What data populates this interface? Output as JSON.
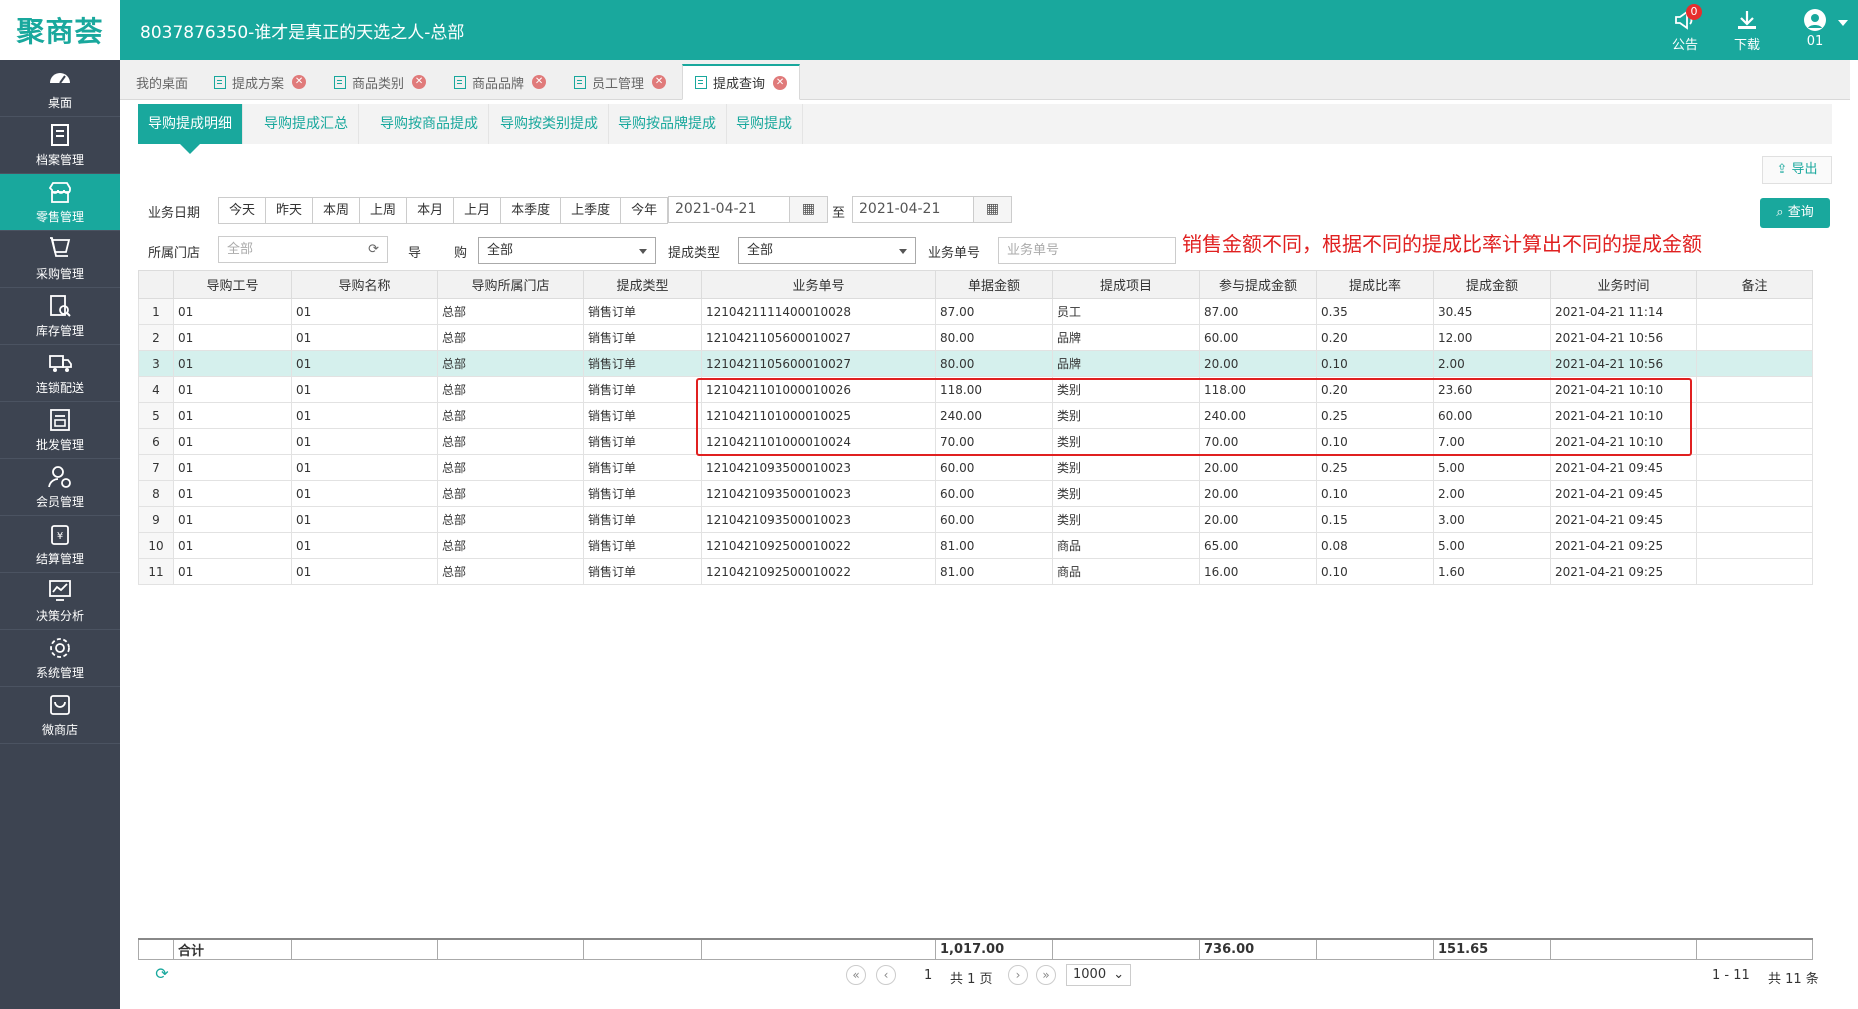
{
  "header": {
    "logo": "聚商荟",
    "title": "8037876350-谁才是真正的天选之人-总部",
    "notice_label": "公告",
    "notice_count": "0",
    "download_label": "下载",
    "user_label": "01"
  },
  "sidebar": {
    "items": [
      {
        "label": "桌面",
        "icon": "dashboard-icon"
      },
      {
        "label": "档案管理",
        "icon": "archive-icon"
      },
      {
        "label": "零售管理",
        "icon": "store-icon",
        "active": true
      },
      {
        "label": "采购管理",
        "icon": "purchase-icon"
      },
      {
        "label": "库存管理",
        "icon": "inventory-icon"
      },
      {
        "label": "连锁配送",
        "icon": "truck-icon"
      },
      {
        "label": "批发管理",
        "icon": "wholesale-icon"
      },
      {
        "label": "会员管理",
        "icon": "member-icon"
      },
      {
        "label": "结算管理",
        "icon": "settlement-icon"
      },
      {
        "label": "决策分析",
        "icon": "chart-icon"
      },
      {
        "label": "系统管理",
        "icon": "gear-icon"
      },
      {
        "label": "微商店",
        "icon": "shop-bag-icon"
      }
    ]
  },
  "tabs": [
    {
      "label": "我的桌面"
    },
    {
      "label": "提成方案"
    },
    {
      "label": "商品类别"
    },
    {
      "label": "商品品牌"
    },
    {
      "label": "员工管理"
    },
    {
      "label": "提成查询"
    }
  ],
  "subtabs": [
    "导购提成明细",
    "导购提成汇总",
    "导购按商品提成",
    "导购按类别提成",
    "导购按品牌提成",
    "导购提成"
  ],
  "toolbar": {
    "export_label": "导出",
    "query_label": "查询"
  },
  "filters": {
    "date_label": "业务日期",
    "date_buttons": [
      "今天",
      "昨天",
      "本周",
      "上周",
      "本月",
      "上月",
      "本季度",
      "上季度",
      "今年"
    ],
    "date_from": "2021-04-21",
    "date_to": "2021-04-21",
    "to_label": "至",
    "store_label": "所属门店",
    "store_value": "全部",
    "guide_label_1": "导",
    "guide_label_2": "购",
    "guide_value": "全部",
    "type_label": "提成类型",
    "type_value": "全部",
    "bizno_label": "业务单号",
    "bizno_placeholder": "业务单号"
  },
  "annotation": "销售金额不同，根据不同的提成比率计算出不同的提成金额",
  "table": {
    "columns": [
      "",
      "导购工号",
      "导购名称",
      "导购所属门店",
      "提成类型",
      "业务单号",
      "单据金额",
      "提成项目",
      "参与提成金额",
      "提成比率",
      "提成金额",
      "业务时间",
      "备注"
    ],
    "rows": [
      [
        "1",
        "01",
        "01",
        "总部",
        "销售订单",
        "1210421111400010028",
        "87.00",
        "员工",
        "87.00",
        "0.35",
        "30.45",
        "2021-04-21 11:14",
        ""
      ],
      [
        "2",
        "01",
        "01",
        "总部",
        "销售订单",
        "1210421105600010027",
        "80.00",
        "品牌",
        "60.00",
        "0.20",
        "12.00",
        "2021-04-21 10:56",
        ""
      ],
      [
        "3",
        "01",
        "01",
        "总部",
        "销售订单",
        "1210421105600010027",
        "80.00",
        "品牌",
        "20.00",
        "0.10",
        "2.00",
        "2021-04-21 10:56",
        ""
      ],
      [
        "4",
        "01",
        "01",
        "总部",
        "销售订单",
        "1210421101000010026",
        "118.00",
        "类别",
        "118.00",
        "0.20",
        "23.60",
        "2021-04-21 10:10",
        ""
      ],
      [
        "5",
        "01",
        "01",
        "总部",
        "销售订单",
        "1210421101000010025",
        "240.00",
        "类别",
        "240.00",
        "0.25",
        "60.00",
        "2021-04-21 10:10",
        ""
      ],
      [
        "6",
        "01",
        "01",
        "总部",
        "销售订单",
        "1210421101000010024",
        "70.00",
        "类别",
        "70.00",
        "0.10",
        "7.00",
        "2021-04-21 10:10",
        ""
      ],
      [
        "7",
        "01",
        "01",
        "总部",
        "销售订单",
        "1210421093500010023",
        "60.00",
        "类别",
        "20.00",
        "0.25",
        "5.00",
        "2021-04-21 09:45",
        ""
      ],
      [
        "8",
        "01",
        "01",
        "总部",
        "销售订单",
        "1210421093500010023",
        "60.00",
        "类别",
        "20.00",
        "0.10",
        "2.00",
        "2021-04-21 09:45",
        ""
      ],
      [
        "9",
        "01",
        "01",
        "总部",
        "销售订单",
        "1210421093500010023",
        "60.00",
        "类别",
        "20.00",
        "0.15",
        "3.00",
        "2021-04-21 09:45",
        ""
      ],
      [
        "10",
        "01",
        "01",
        "总部",
        "销售订单",
        "1210421092500010022",
        "81.00",
        "商品",
        "65.00",
        "0.08",
        "5.00",
        "2021-04-21 09:25",
        ""
      ],
      [
        "11",
        "01",
        "01",
        "总部",
        "销售订单",
        "1210421092500010022",
        "81.00",
        "商品",
        "16.00",
        "0.10",
        "1.60",
        "2021-04-21 09:25",
        ""
      ]
    ],
    "highlighted_row": 3,
    "totals": {
      "label": "合计",
      "bill_amount": "1,017.00",
      "commission_base": "736.00",
      "commission": "151.65"
    }
  },
  "pager": {
    "page": "1",
    "total_pages": "共 1 页",
    "page_size": "1000",
    "range": "1 - 11",
    "total": "共 11 条"
  },
  "colors": {
    "accent": "#19a89d",
    "sidebar": "#3d4451",
    "annotation": "#e02020"
  }
}
